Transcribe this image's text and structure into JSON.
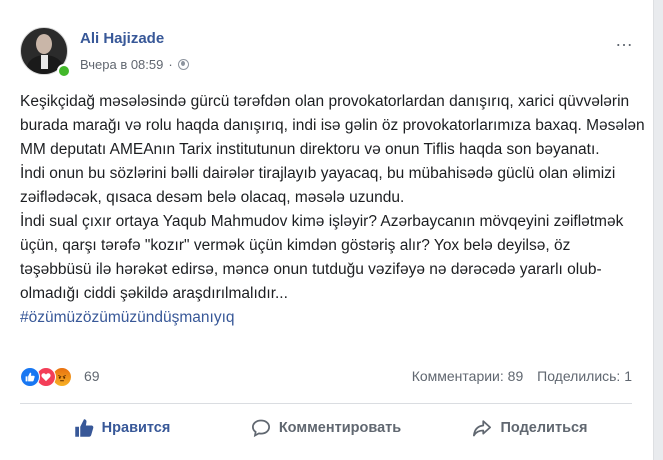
{
  "post": {
    "author": "Ali Hajizade",
    "time": "Вчера в 08:59",
    "separator": "·",
    "more_icon": "…",
    "paragraphs": [
      "Keşikçidağ məsələsində gürcü tərəfdən olan provokatorlardan danışırıq, xarici qüvvələrin burada marağı və rolu haqda danışırıq, indi isə gəlin öz provokatorlarımıza baxaq. Məsələn MM deputatı AMEAnın Tarix institutunun direktoru və onun Tiflis haqda son bəyanatı.",
      "İndi onun bu sözlərini bəlli dairələr tirajlayıb yayacaq, bu mübahisədə güclü olan əlimizi zəiflədəcək, qısaca desəm belə olacaq, məsələ uzundu.",
      "İndi sual çıxır ortaya Yaqub Mahmudov kimə işləyir? Azərbaycanın mövqeyini zəiflətmək üçün, qarşı tərəfə \"kozır\" vermək üçün kimdən göstəriş alır? Yox belə deyilsə, öz təşəbbüsü ilə hərəkət edirsə, məncə onun tutduğu vəzifəyə nə dərəcədə yararlı olub-olmadığı ciddi şəkildə araşdırılmalıdır..."
    ],
    "hashtag": "#özümüzözümüzündüşmanıyıq"
  },
  "reactions": {
    "types": [
      "like",
      "love",
      "angry"
    ],
    "count": "69",
    "comments": "Комментарии: 89",
    "shares": "Поделились: 1"
  },
  "actions": {
    "like": "Нравится",
    "comment": "Комментировать",
    "share": "Поделиться"
  },
  "colors": {
    "link": "#385898",
    "online": "#42b72a",
    "like": "#1877f2",
    "love": "#f33e58",
    "angry": "#e9710f"
  }
}
